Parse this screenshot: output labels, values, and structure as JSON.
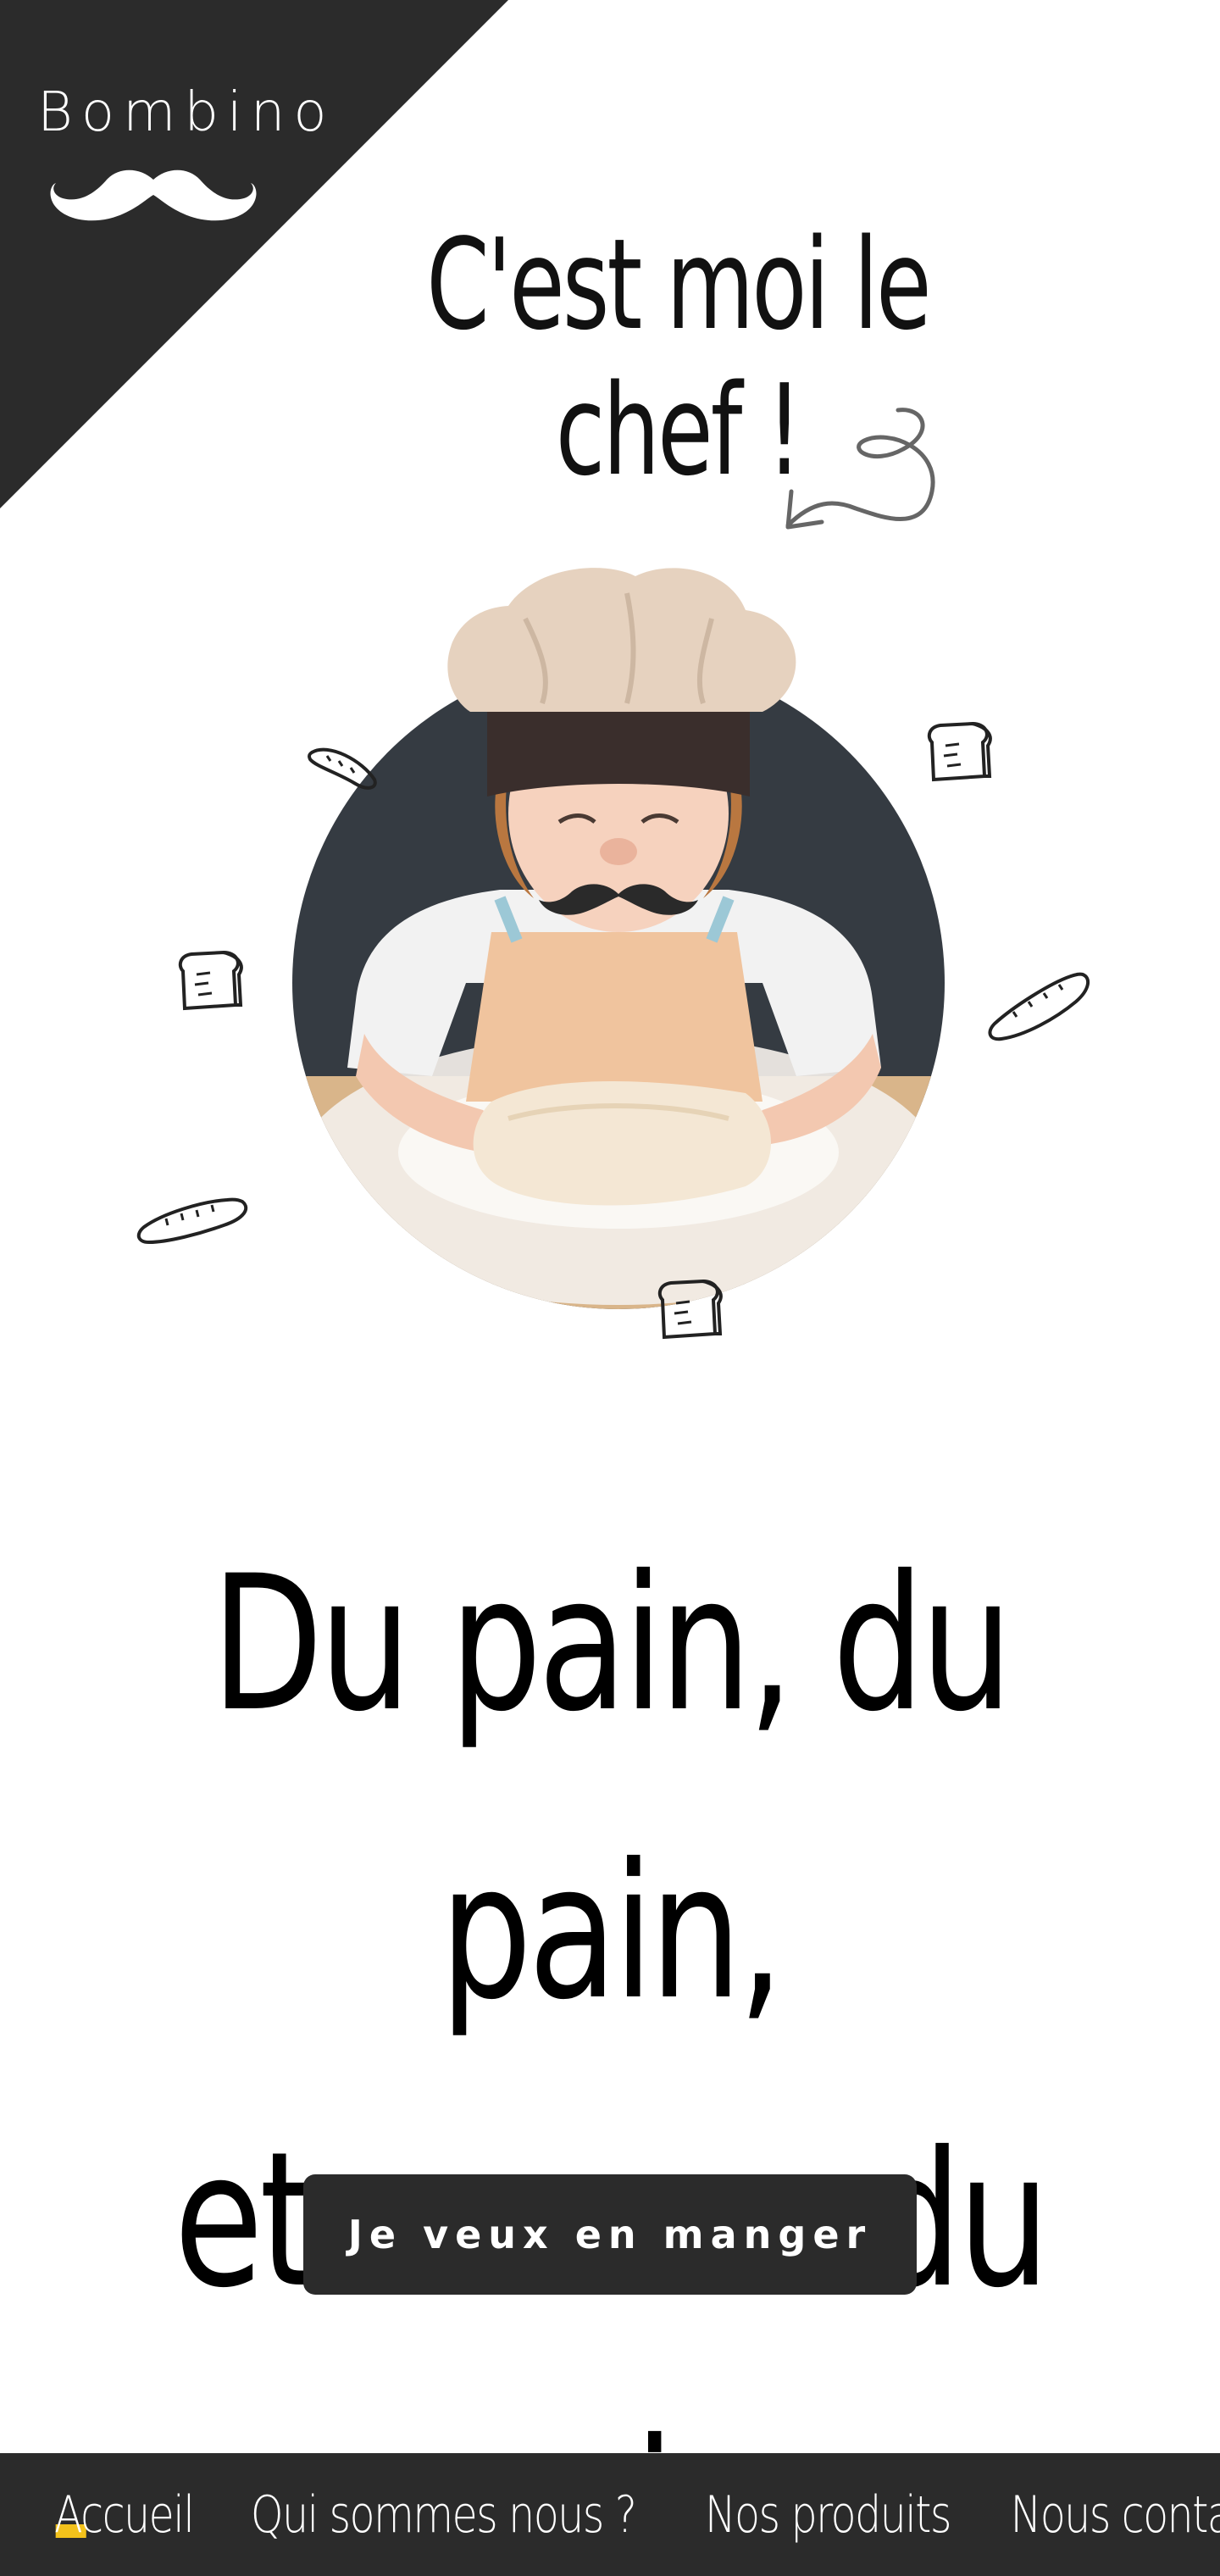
{
  "brand": {
    "name": "Bombino",
    "logo_icon": "mustache-logo-icon"
  },
  "hero": {
    "title": "C'est moi le chef !",
    "image_icon": "child-baker-photo"
  },
  "tagline": {
    "line1": "Du pain, du pain,",
    "line2": "et encore du pain"
  },
  "cta": {
    "label": "Je veux en manger"
  },
  "nav": {
    "items": [
      {
        "label": "Accueil",
        "active": true
      },
      {
        "label": "Qui sommes nous ?",
        "active": false
      },
      {
        "label": "Nos produits",
        "active": false
      },
      {
        "label": "Nous contacter",
        "active": false
      }
    ]
  },
  "colors": {
    "dark": "#2b2b2b",
    "accent": "#f3c21b",
    "circle": "#353b42",
    "background": "#ffffff"
  }
}
